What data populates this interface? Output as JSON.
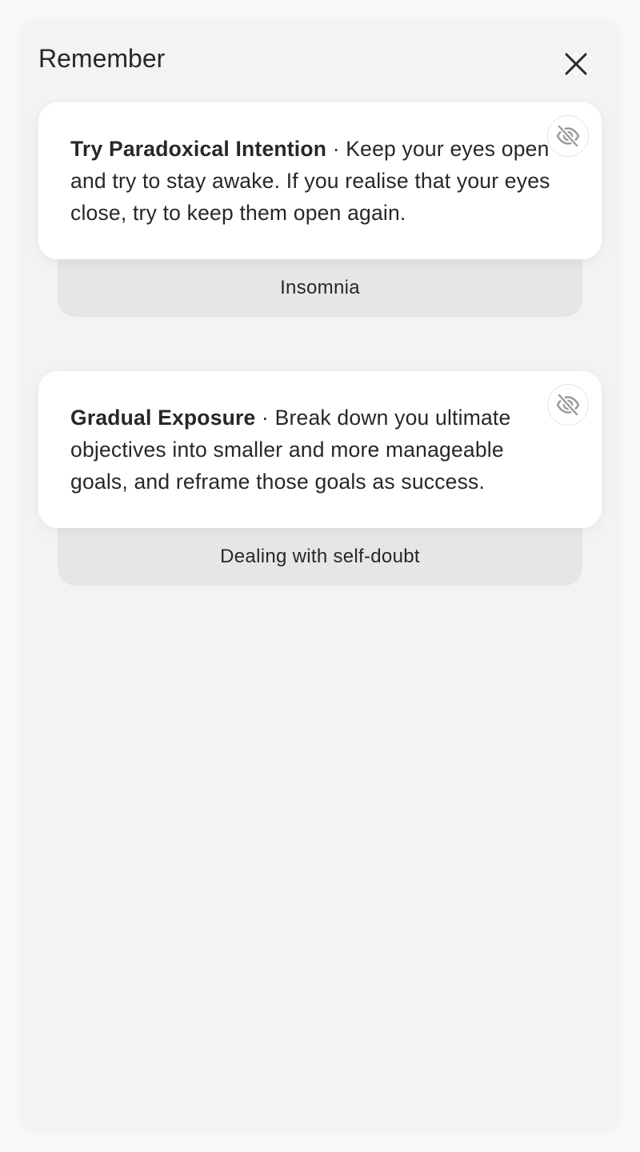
{
  "panel": {
    "title": "Remember",
    "close_icon": "close-icon"
  },
  "cards": [
    {
      "title": "Try Paradoxical Intention",
      "separator": " · ",
      "body": "Keep your eyes open and try to stay awake. If you realise that your eyes close, try to keep them open again.",
      "category": "Insomnia",
      "hide_icon": "eye-off-icon"
    },
    {
      "title": "Gradual Exposure",
      "separator": " · ",
      "body": "Break down you ultimate objectives into smaller and more manageable goals, and reframe those goals as success.",
      "category": "Dealing with self-doubt",
      "hide_icon": "eye-off-icon"
    }
  ],
  "colors": {
    "page_background": "#f8f8f8",
    "panel_background": "#f3f3f3",
    "card_background": "#ffffff",
    "category_background": "#e6e6e6",
    "text": "#2b2626",
    "icon_muted": "#9a9a9a"
  }
}
